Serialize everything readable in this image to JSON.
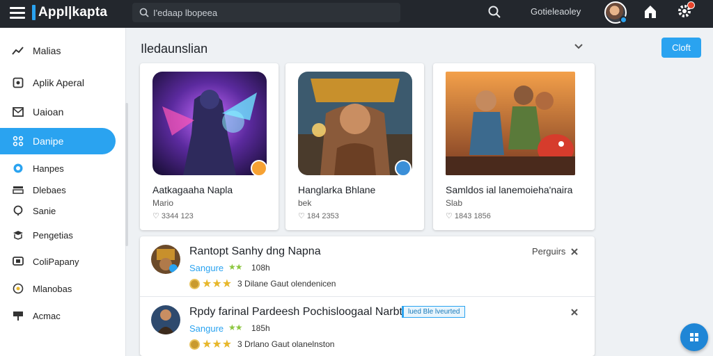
{
  "topbar": {
    "logo_text": "Appl|kapta",
    "search_placeholder": "I'edaap lbopeea",
    "user_name": "Gotieleaoley",
    "search_icon": "search-icon",
    "home_icon": "home-icon",
    "settings_icon": "settings-icon",
    "accent": "#2aa3f0"
  },
  "sidebar": {
    "items": [
      {
        "label": "Malias",
        "icon": "trending-icon"
      },
      {
        "label": "Aplik Aperal",
        "icon": "apps-icon"
      },
      {
        "label": "Uaioan",
        "icon": "mail-icon"
      },
      {
        "label": "Danipe",
        "icon": "games-icon",
        "active": true
      },
      {
        "label": "Hanpes",
        "icon": "circle-icon"
      },
      {
        "label": "Dlebaes",
        "icon": "media-icon"
      },
      {
        "label": "Sanie",
        "icon": "search-icon"
      },
      {
        "label": "Pengetias",
        "icon": "book-icon"
      },
      {
        "label": "ColiPapany",
        "icon": "tv-icon"
      },
      {
        "label": "Mlanobas",
        "icon": "music-icon"
      },
      {
        "label": "Acmac",
        "icon": "sign-icon"
      }
    ]
  },
  "main": {
    "section_title": "Iledaunslian",
    "create_label": "Cloft",
    "cards": [
      {
        "title": "Aatkagaaha Napla",
        "sub": "Mario",
        "meta": "♡ 3344 123"
      },
      {
        "title": "Hanglarka Bhlane",
        "sub": "bek",
        "meta": "♡ 184 2353"
      },
      {
        "title": "Samldos ial lanemoieha'naira",
        "sub": "Slab",
        "meta": "♡ 1843 1856"
      }
    ],
    "list": [
      {
        "name": "Rantopt Sanhy dng Napna",
        "category": "Sangure",
        "size": "108h",
        "rating_text": "3 Dilane Gaut olendenicen",
        "row_label": "Perguirs"
      },
      {
        "name": "Rpdy farinal Pardeesh Pochisloogaal Narbt",
        "category": "Sangure",
        "size": "185h",
        "rating_text": "3 Drlano Gaut olanelnston",
        "tag": "lued Ble lveurted"
      }
    ]
  }
}
